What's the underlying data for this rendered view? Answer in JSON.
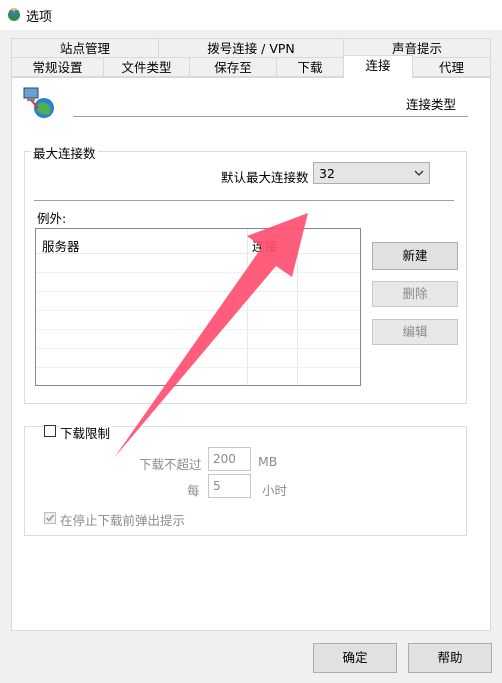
{
  "window": {
    "title": "选项"
  },
  "tabs_row1": [
    "站点管理",
    "拨号连接 / VPN",
    "声音提示"
  ],
  "tabs_row2": [
    "常规设置",
    "文件类型",
    "保存至",
    "下载",
    "连接",
    "代理"
  ],
  "active_tab": "连接",
  "header": {
    "label": "连接类型"
  },
  "max_connections": {
    "group_title": "最大连接数",
    "default_label": "默认最大连接数",
    "default_value": "32",
    "exceptions_label": "例外:",
    "table_headers": [
      "服务器",
      "连接"
    ],
    "buttons": {
      "new": "新建",
      "delete": "删除",
      "edit": "编辑"
    }
  },
  "download_limit": {
    "checkbox_label": "下载限制",
    "limit_label": "下载不超过",
    "limit_value": "200",
    "limit_unit": "MB",
    "every_label": "每",
    "every_value": "5",
    "every_unit": "小时",
    "popup_label": "在停止下载前弹出提示"
  },
  "footer": {
    "ok": "确定",
    "help": "帮助"
  },
  "colors": {
    "accent_arrow": "#ff4f70"
  }
}
